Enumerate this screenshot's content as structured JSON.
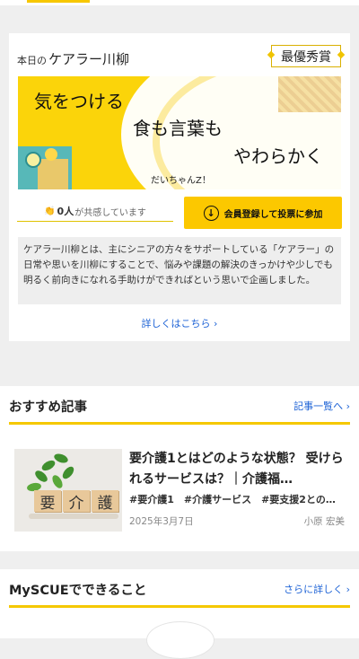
{
  "senryu": {
    "title_small": "本日の",
    "title_big": "ケアラー川柳",
    "award": "最優秀賞",
    "poem_line1": "気をつける",
    "poem_line2": "食も言葉も",
    "poem_line3": "やわらかく",
    "author": "だいちゃんZ！",
    "empathy_count": "0人",
    "empathy_suffix": "が共感しています",
    "vote_button": "会員登録して投票に参加",
    "description": "ケアラー川柳とは、主にシニアの方々をサポートしている「ケアラー」の日常や思いを川柳にすることで、悩みや課題の解決のきっかけや少しでも明るく前向きになれる手助けができればという思いで企画しました。",
    "more_link": "詳しくはこちら ›"
  },
  "recommended": {
    "heading": "おすすめ記事",
    "list_link": "記事一覧へ ›",
    "article": {
      "image_text": [
        "要",
        "介",
        "護"
      ],
      "title": "要介護1とはどのような状態？ 受けられるサービスは？｜介護福…",
      "tags": "#要介護1　#介護サービス　#要支援2との…",
      "date": "2025年3月7日",
      "author": "小原 宏美"
    }
  },
  "myscue": {
    "heading": "MySCUEでできること",
    "link": "さらに詳しく ›"
  },
  "colors": {
    "accent": "#fcc800",
    "link": "#1e63d6"
  }
}
